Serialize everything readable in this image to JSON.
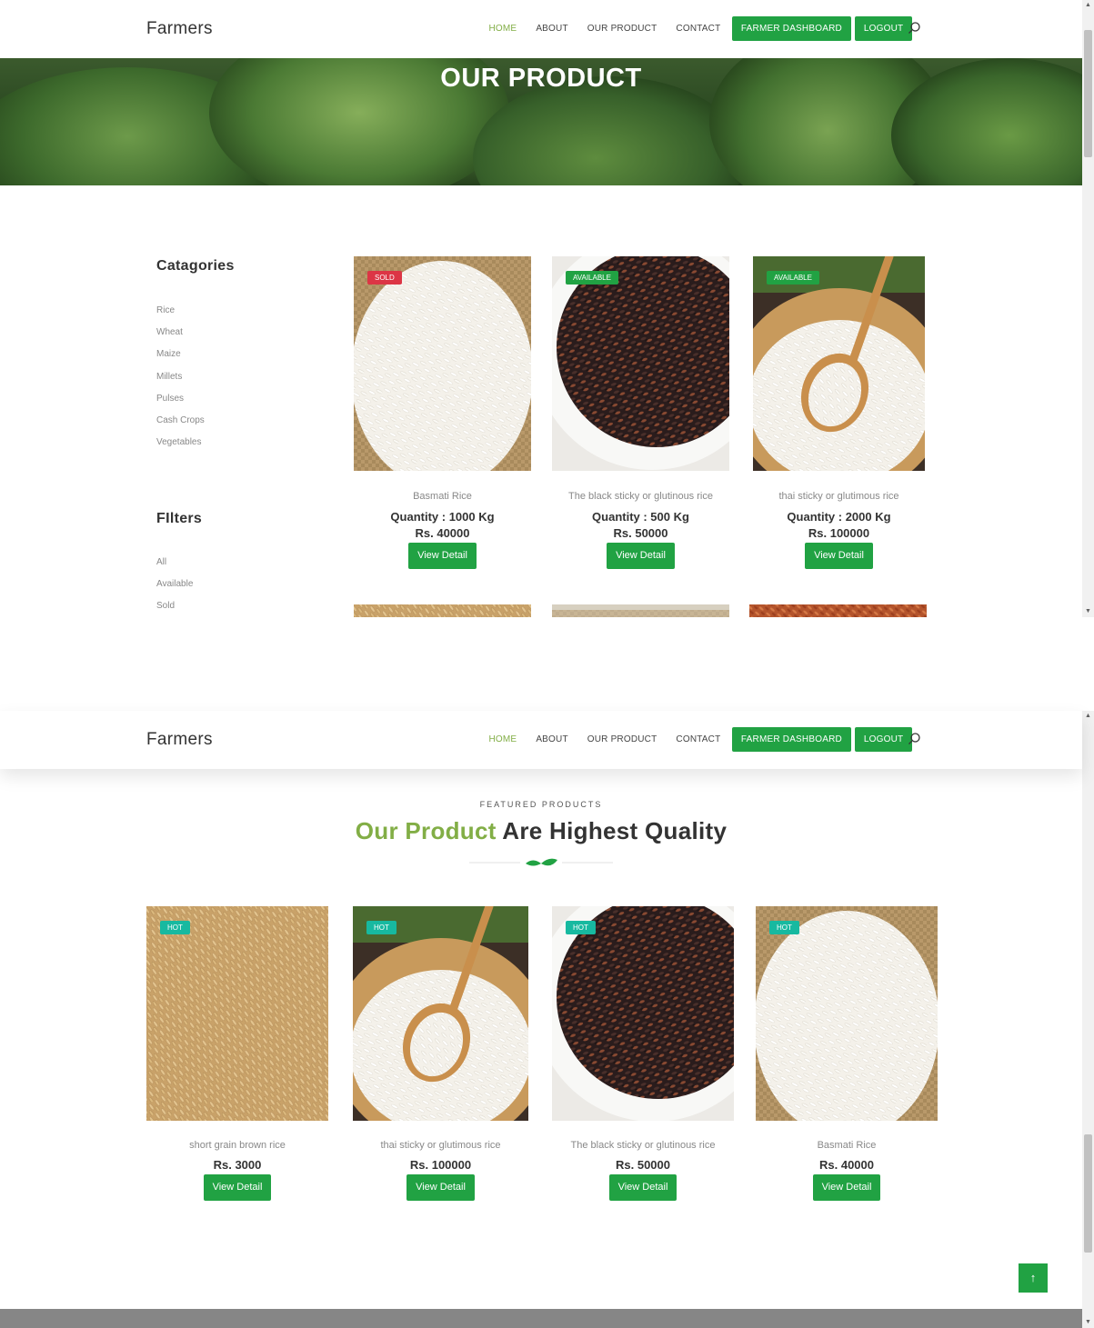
{
  "header": {
    "brand": "Farmers",
    "nav": [
      "HOME",
      "ABOUT",
      "OUR PRODUCT",
      "CONTACT"
    ],
    "dashboard_button": "FARMER DASHBOARD",
    "logout_button": "LOGOUT"
  },
  "hero": {
    "title": "OUR PRODUCT"
  },
  "sidebar": {
    "categories_heading": "Catagories",
    "categories": [
      "Rice",
      "Wheat",
      "Maize",
      "Millets",
      "Pulses",
      "Cash Crops",
      "Vegetables"
    ],
    "filters_heading": "FIlters",
    "filters": [
      "All",
      "Available",
      "Sold"
    ]
  },
  "products": [
    {
      "badge": "SOLD",
      "name": "Basmati Rice",
      "quantity": "Quantity : 1000 Kg",
      "price": "Rs. 40000",
      "button": "View Detail"
    },
    {
      "badge": "AVAILABLE",
      "name": "The black sticky or glutinous rice",
      "quantity": "Quantity : 500 Kg",
      "price": "Rs. 50000",
      "button": "View Detail"
    },
    {
      "badge": "AVAILABLE",
      "name": "thai sticky or glutimous rice",
      "quantity": "Quantity : 2000 Kg",
      "price": "Rs. 100000",
      "button": "View Detail"
    }
  ],
  "featured": {
    "subheading": "FEATURED PRODUCTS",
    "title_highlight": "Our Product",
    "title_rest": " Are Highest Quality",
    "items": [
      {
        "badge": "HOT",
        "name": "short grain brown rice",
        "price": "Rs. 3000",
        "button": "View Detail"
      },
      {
        "badge": "HOT",
        "name": "thai sticky or glutimous rice",
        "price": "Rs. 100000",
        "button": "View Detail"
      },
      {
        "badge": "HOT",
        "name": "The black sticky or glutinous rice",
        "price": "Rs. 50000",
        "button": "View Detail"
      },
      {
        "badge": "HOT",
        "name": "Basmati Rice",
        "price": "Rs. 40000",
        "button": "View Detail"
      }
    ]
  },
  "scroll_top_icon": "arrow-up-icon",
  "colors": {
    "primary_green": "#21a243",
    "accent_green": "#82ae46",
    "sold_red": "#dc3545",
    "hot_teal": "#17b9a0"
  }
}
